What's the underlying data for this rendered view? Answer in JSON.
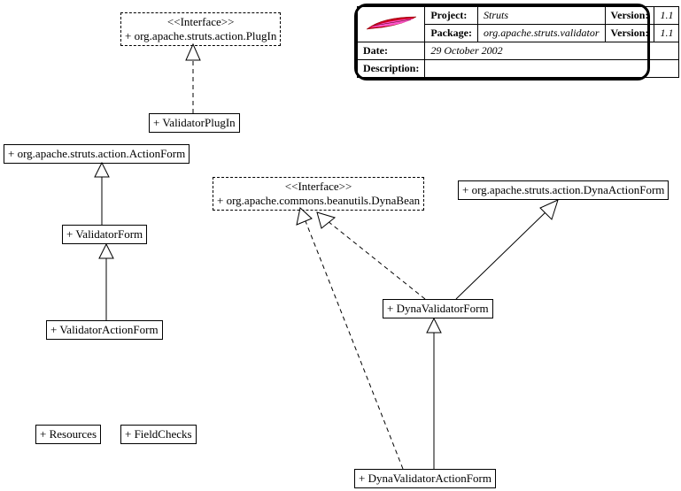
{
  "info": {
    "project_label": "Project:",
    "project_value": "Struts",
    "version_label": "Version:",
    "version_value": "1.1",
    "package_label": "Package:",
    "package_value": "org.apache.struts.validator",
    "pkg_version_label": "Version:",
    "pkg_version_value": "1.1",
    "date_label": "Date:",
    "date_value": "29 October 2002",
    "description_label": "Description:"
  },
  "nodes": {
    "plugin_iface_st": "<<Interface>>",
    "plugin_iface": "+ org.apache.struts.action.PlugIn",
    "validator_plugin": "+ ValidatorPlugIn",
    "action_form": "+ org.apache.struts.action.ActionForm",
    "validator_form": "+ ValidatorForm",
    "validator_action_form": "+ ValidatorActionForm",
    "resources": "+ Resources",
    "field_checks": "+ FieldChecks",
    "dynabean_iface_st": "<<Interface>>",
    "dynabean_iface": "+ org.apache.commons.beanutils.DynaBean",
    "dyna_action_form": "+ org.apache.struts.action.DynaActionForm",
    "dyna_validator_form": "+ DynaValidatorForm",
    "dyna_validator_action_form": "+ DynaValidatorActionForm"
  },
  "chart_data": {
    "type": "uml-class-diagram",
    "nodes": [
      {
        "id": "PlugIn",
        "name": "org.apache.struts.action.PlugIn",
        "kind": "interface"
      },
      {
        "id": "ValidatorPlugIn",
        "name": "ValidatorPlugIn",
        "kind": "class"
      },
      {
        "id": "ActionForm",
        "name": "org.apache.struts.action.ActionForm",
        "kind": "class"
      },
      {
        "id": "ValidatorForm",
        "name": "ValidatorForm",
        "kind": "class"
      },
      {
        "id": "ValidatorActionForm",
        "name": "ValidatorActionForm",
        "kind": "class"
      },
      {
        "id": "Resources",
        "name": "Resources",
        "kind": "class"
      },
      {
        "id": "FieldChecks",
        "name": "FieldChecks",
        "kind": "class"
      },
      {
        "id": "DynaBean",
        "name": "org.apache.commons.beanutils.DynaBean",
        "kind": "interface"
      },
      {
        "id": "DynaActionForm",
        "name": "org.apache.struts.action.DynaActionForm",
        "kind": "class"
      },
      {
        "id": "DynaValidatorForm",
        "name": "DynaValidatorForm",
        "kind": "class"
      },
      {
        "id": "DynaValidatorActionForm",
        "name": "DynaValidatorActionForm",
        "kind": "class"
      }
    ],
    "edges": [
      {
        "from": "ValidatorPlugIn",
        "to": "PlugIn",
        "type": "realization"
      },
      {
        "from": "ValidatorForm",
        "to": "ActionForm",
        "type": "generalization"
      },
      {
        "from": "ValidatorActionForm",
        "to": "ValidatorForm",
        "type": "generalization"
      },
      {
        "from": "DynaValidatorForm",
        "to": "DynaBean",
        "type": "realization"
      },
      {
        "from": "DynaValidatorForm",
        "to": "DynaActionForm",
        "type": "generalization"
      },
      {
        "from": "DynaValidatorActionForm",
        "to": "DynaBean",
        "type": "realization"
      },
      {
        "from": "DynaValidatorActionForm",
        "to": "DynaValidatorForm",
        "type": "generalization"
      }
    ]
  }
}
